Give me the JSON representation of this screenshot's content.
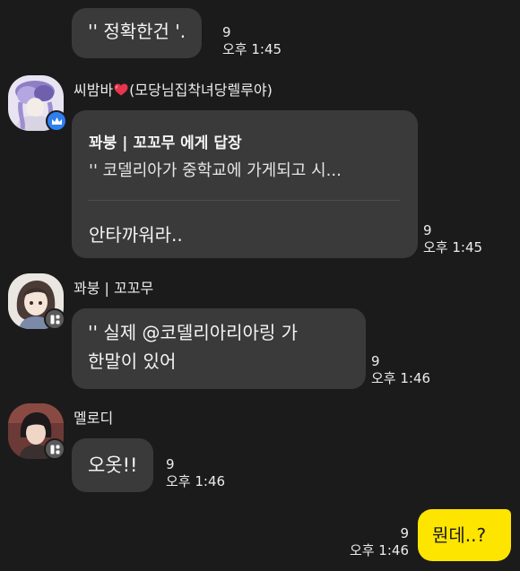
{
  "messages": {
    "m1": {
      "text": "'' 정확한건 '.",
      "count": "9",
      "time": "오후 1:45"
    },
    "m2": {
      "sender": "씨밤바",
      "sender_suffix": "(모당님집착녀당렐루야)",
      "reply_header": "꽈붕 | 꼬꼬무 에게 답장",
      "reply_quote": "''  코델리아가 중학교에 가게되고 시...",
      "text": "안타까워라..",
      "count": "9",
      "time": "오후 1:45"
    },
    "m3": {
      "sender": "꽈붕 | 꼬꼬무",
      "line1_prefix": "'' 실제 ",
      "mention": "@코델리아리아링",
      "line1_suffix": "  가",
      "line2": "한말이 있어",
      "count": "9",
      "time": "오후 1:46"
    },
    "m4": {
      "sender": "멜로디",
      "text": "오옷!!",
      "count": "9",
      "time": "오후 1:46"
    },
    "m5": {
      "text": "뭔데..?",
      "count": "9",
      "time": "오후 1:46"
    }
  },
  "colors": {
    "background": "#1b1b1b",
    "bubble": "#3a3a3a",
    "my_bubble": "#fee500",
    "badge_blue": "#2f7ff0",
    "badge_gray": "#5a5a5a"
  },
  "icons": {
    "heart": "heart-icon",
    "crown": "crown-icon",
    "profile_badge": "grid-badge-icon"
  }
}
